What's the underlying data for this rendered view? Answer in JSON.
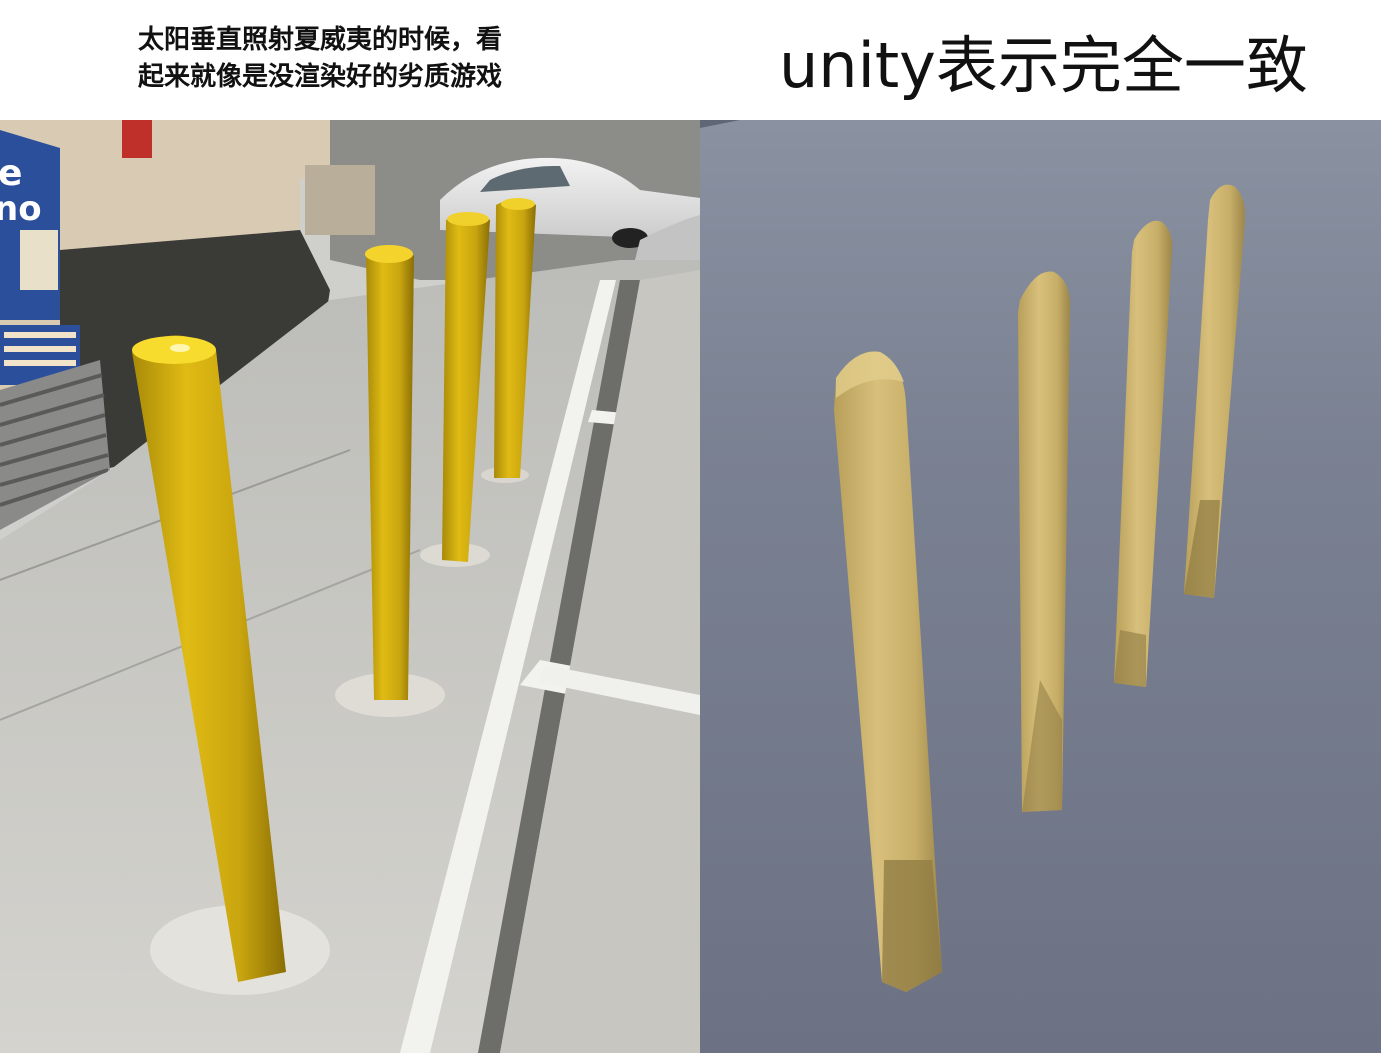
{
  "captions": {
    "left_line1": "太阳垂直照射夏威夷的时候，看",
    "left_line2": "起来就像是没渲染好的劣质游戏",
    "right_title": "unity表示完全一致"
  },
  "photo_sign": {
    "letters_top": "e",
    "letters_mid": "no"
  },
  "colors": {
    "pole_yellow": "#d6b012",
    "pole_shadow": "#8a6e05",
    "render_pole": "#c9b06a",
    "render_bg": "#72798a"
  }
}
